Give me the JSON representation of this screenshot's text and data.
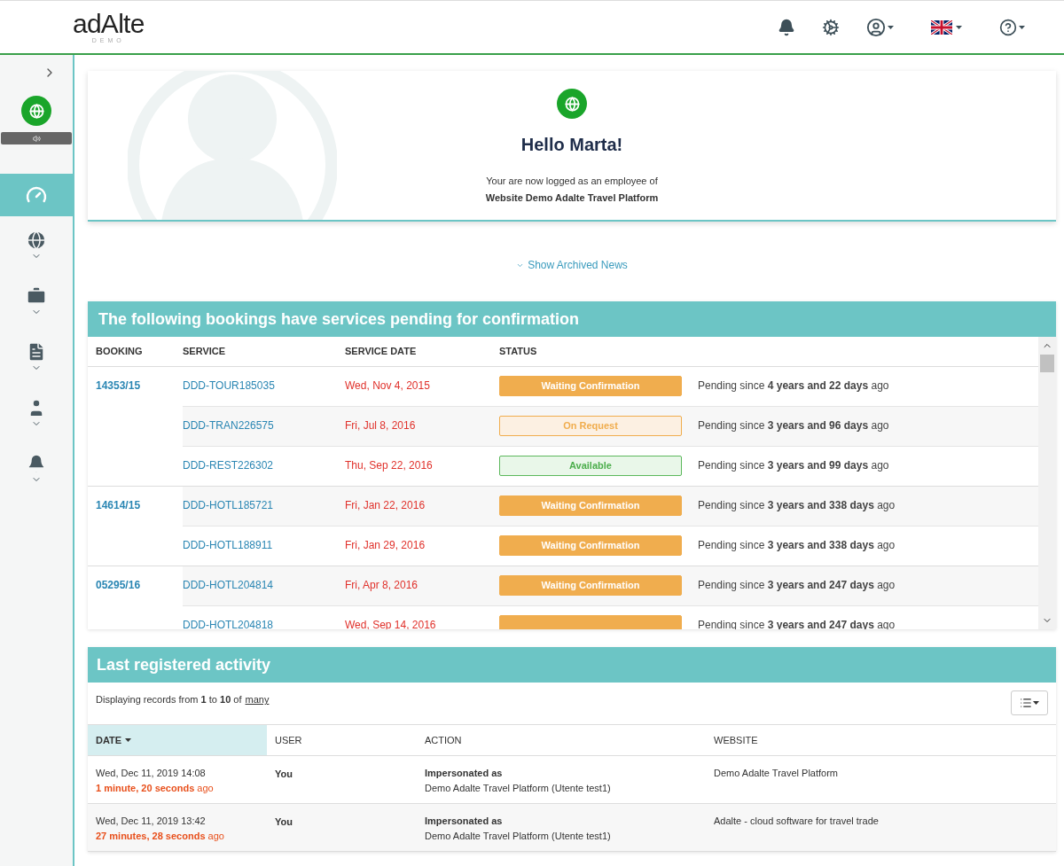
{
  "header": {
    "logo": "adAlte",
    "logo_sub": "DEMO"
  },
  "sidebar": {
    "items": [
      {
        "kind": "dashboard",
        "selected": true,
        "expandable": false
      },
      {
        "kind": "globe",
        "selected": false,
        "expandable": true
      },
      {
        "kind": "briefcase",
        "selected": false,
        "expandable": true
      },
      {
        "kind": "file",
        "selected": false,
        "expandable": true
      },
      {
        "kind": "user",
        "selected": false,
        "expandable": true
      },
      {
        "kind": "bell",
        "selected": false,
        "expandable": true
      }
    ]
  },
  "welcome": {
    "title": "Hello Marta!",
    "subtitle": "Your are now logged as an employee of",
    "company": "Website Demo Adalte Travel Platform"
  },
  "archived_link": "Show Archived News",
  "bookings": {
    "title": "The following bookings have services pending for confirmation",
    "columns": [
      "BOOKING",
      "SERVICE",
      "SERVICE DATE",
      "STATUS"
    ],
    "groups": [
      {
        "booking": "14353/15",
        "services": [
          {
            "code": "DDD-TOUR185035",
            "date": "Wed, Nov 4, 2015",
            "status": "Waiting Confirmation",
            "kind": "waiting",
            "pending": "Pending since **4 years and 22 days** ago"
          },
          {
            "code": "DDD-TRAN226575",
            "date": "Fri, Jul 8, 2016",
            "status": "On Request",
            "kind": "request",
            "pending": "Pending since **3 years and 96 days** ago"
          },
          {
            "code": "DDD-REST226302",
            "date": "Thu, Sep 22, 2016",
            "status": "Available",
            "kind": "available",
            "pending": "Pending since **3 years and 99 days** ago"
          }
        ]
      },
      {
        "booking": "14614/15",
        "services": [
          {
            "code": "DDD-HOTL185721",
            "date": "Fri, Jan 22, 2016",
            "status": "Waiting Confirmation",
            "kind": "waiting",
            "pending": "Pending since **3 years and 338 days** ago"
          },
          {
            "code": "DDD-HOTL188911",
            "date": "Fri, Jan 29, 2016",
            "status": "Waiting Confirmation",
            "kind": "waiting",
            "pending": "Pending since **3 years and 338 days** ago"
          }
        ]
      },
      {
        "booking": "05295/16",
        "services": [
          {
            "code": "DDD-HOTL204814",
            "date": "Fri, Apr 8, 2016",
            "status": "Waiting Confirmation",
            "kind": "waiting",
            "pending": "Pending since **3 years and 247 days** ago"
          },
          {
            "code": "DDD-HOTL204818",
            "date": "Wed, Sep 14, 2016",
            "kind": "waiting",
            "pending": "Pending since **3 years and 247 days** ago"
          }
        ]
      }
    ]
  },
  "activity": {
    "title": "Last registered activity",
    "records_text": "Displaying records from **1** to **10** of",
    "records_link": "many",
    "columns": [
      {
        "label": "DATE",
        "sorted": true
      },
      {
        "label": "USER",
        "sorted": false
      },
      {
        "label": "ACTION",
        "sorted": false
      },
      {
        "label": "WEBSITE",
        "sorted": false
      }
    ],
    "rows": [
      {
        "date": "Wed, Dec 11, 2019 14:08",
        "ago": "**1 minute, 20 seconds** ago",
        "user": "You",
        "action": "Impersonated as",
        "detail": "Demo Adalte Travel Platform (Utente test1)",
        "website": "Demo Adalte Travel Platform"
      },
      {
        "date": "Wed, Dec 11, 2019 13:42",
        "ago": "**27 minutes, 28 seconds** ago",
        "user": "You",
        "action": "Impersonated as",
        "detail": "Demo Adalte Travel Platform (Utente test1)",
        "website": "Adalte - cloud software for travel trade"
      }
    ]
  }
}
